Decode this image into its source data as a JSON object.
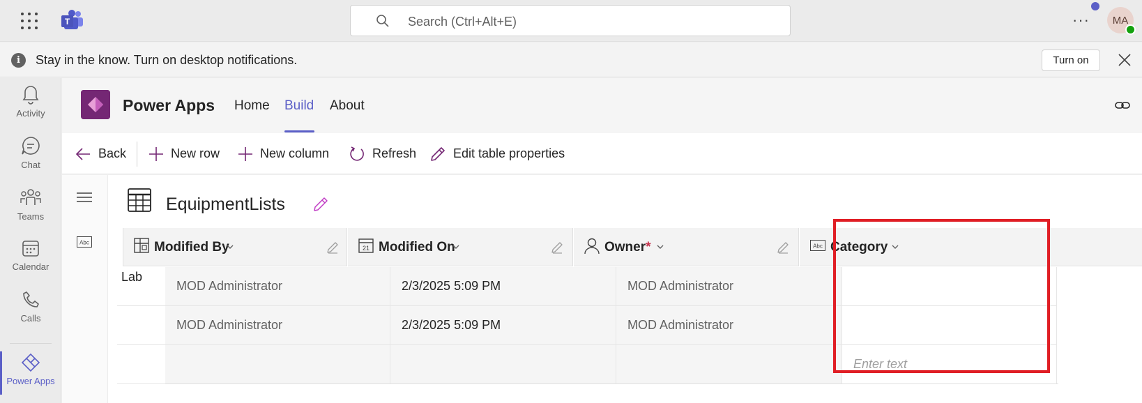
{
  "topbar": {
    "search_placeholder": "Search (Ctrl+Alt+E)",
    "more_label": "···",
    "avatar_initials": "MA"
  },
  "notice": {
    "text": "Stay in the know. Turn on desktop notifications.",
    "button": "Turn on"
  },
  "rail": {
    "items": [
      {
        "label": "Activity",
        "icon": "bell-icon"
      },
      {
        "label": "Chat",
        "icon": "chat-icon"
      },
      {
        "label": "Teams",
        "icon": "teams-icon"
      },
      {
        "label": "Calendar",
        "icon": "calendar-icon"
      },
      {
        "label": "Calls",
        "icon": "phone-icon"
      },
      {
        "label": "Power Apps",
        "icon": "power-apps-icon"
      }
    ],
    "active": "Power Apps"
  },
  "app": {
    "name": "Power Apps",
    "tabs": [
      "Home",
      "Build",
      "About"
    ],
    "active_tab": "Build"
  },
  "commands": {
    "back": "Back",
    "new_row": "New row",
    "new_column": "New column",
    "refresh": "Refresh",
    "edit_props": "Edit table properties"
  },
  "table": {
    "title": "EquipmentLists",
    "columns": [
      {
        "label": "Modified By",
        "icon": "lookup-icon"
      },
      {
        "label": "Modified On",
        "icon": "calendar-date-icon"
      },
      {
        "label": "Owner",
        "icon": "person-icon",
        "required": "*"
      },
      {
        "label": "Category",
        "icon": "text-abc-icon"
      }
    ],
    "row_labels": [
      "Lab",
      ""
    ],
    "rows": [
      [
        "MOD Administrator",
        "2/3/2025 5:09 PM",
        "MOD Administrator",
        ""
      ],
      [
        "MOD Administrator",
        "2/3/2025 5:09 PM",
        "MOD Administrator",
        ""
      ]
    ],
    "new_row_placeholder": "Enter text",
    "date_icon_label": "21"
  },
  "colors": {
    "accent": "#5b5fc7",
    "power_apps": "#742774",
    "highlight": "#e01e25"
  }
}
